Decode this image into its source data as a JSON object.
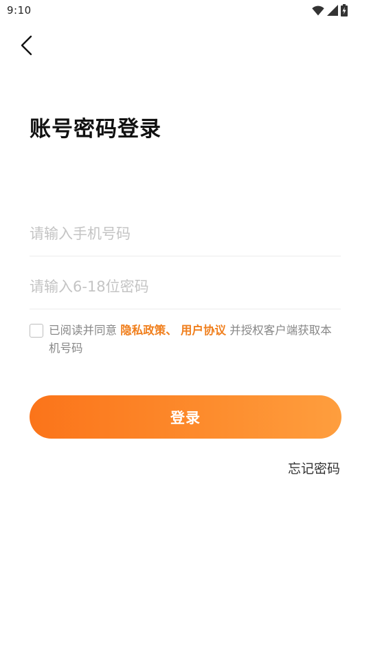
{
  "status_bar": {
    "time": "9:10",
    "icons": [
      "wifi-icon",
      "cellular-signal-icon",
      "battery-charging-icon"
    ]
  },
  "header": {
    "back_icon": "chevron-left-icon"
  },
  "title": "账号密码登录",
  "form": {
    "phone": {
      "value": "",
      "placeholder": "请输入手机号码"
    },
    "password": {
      "value": "",
      "placeholder": "请输入6-18位密码"
    }
  },
  "agreement": {
    "checked": false,
    "prefix": "已阅读并同意 ",
    "privacy_link": "隐私政策、",
    "separator": " ",
    "terms_link": "用户协议",
    "suffix": " 并授权客户端获取本机号码"
  },
  "login_button": "登录",
  "forgot_password": "忘记密码",
  "colors": {
    "accent": "#f07f1d",
    "button_start": "#fb741a",
    "button_end": "#fe9e3e"
  }
}
